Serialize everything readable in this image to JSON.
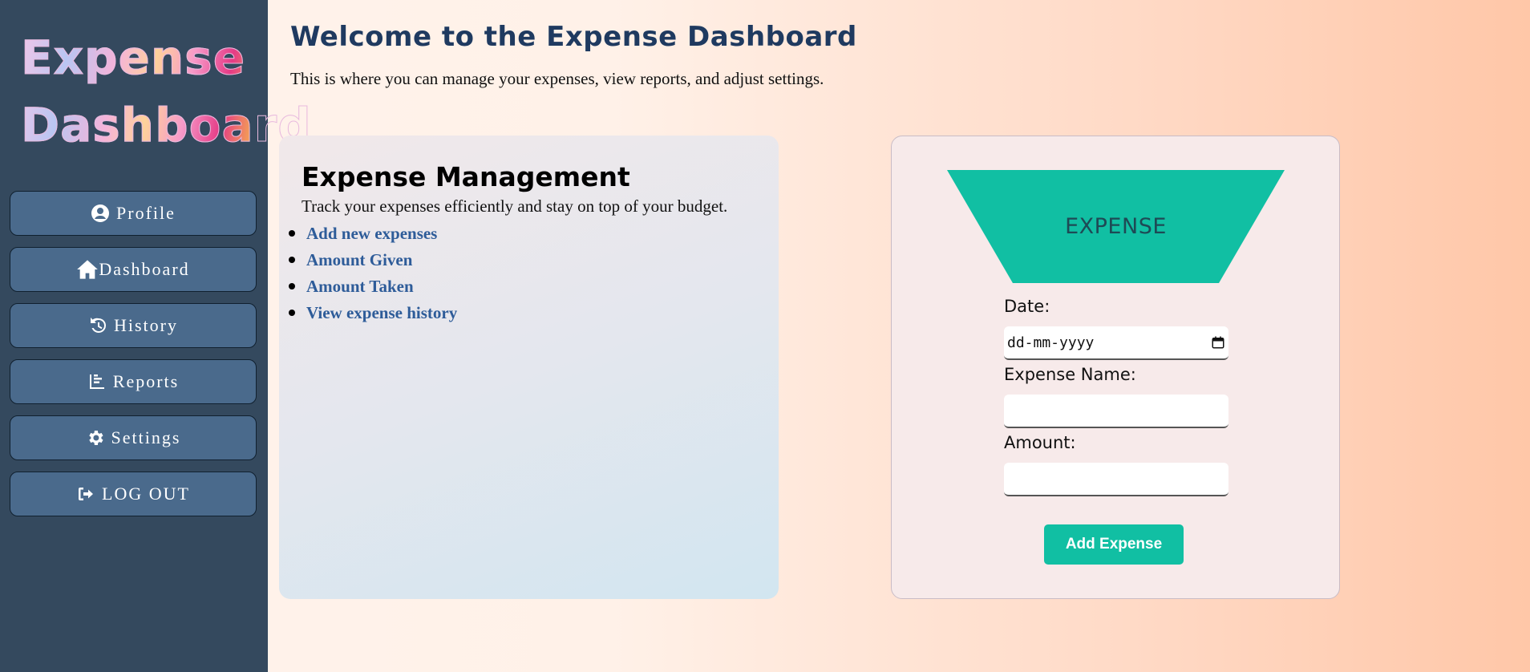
{
  "sidebar": {
    "logo_line1": "Expense",
    "logo_line2": "Dashboard",
    "items": [
      {
        "label": "Profile",
        "icon": "user-circle-icon"
      },
      {
        "label": "Dashboard",
        "icon": "home-icon"
      },
      {
        "label": "History",
        "icon": "history-icon"
      },
      {
        "label": "Reports",
        "icon": "chart-icon"
      },
      {
        "label": "Settings",
        "icon": "gear-icon"
      },
      {
        "label": "LOG OUT",
        "icon": "logout-icon"
      }
    ]
  },
  "header": {
    "title": "Welcome to the Expense Dashboard",
    "subtitle": "This is where you can manage your expenses, view reports, and adjust settings."
  },
  "management": {
    "title": "Expense Management",
    "description": "Track your expenses efficiently and stay on top of your budget.",
    "links": [
      "Add new expenses",
      "Amount Given",
      "Amount Taken",
      "View expense history"
    ]
  },
  "form": {
    "banner": "EXPENSE",
    "date_label": "Date:",
    "date_placeholder": "dd-mm-yyyy",
    "name_label": "Expense Name:",
    "name_value": "",
    "amount_label": "Amount:",
    "amount_value": "",
    "submit_label": "Add Expense"
  },
  "colors": {
    "sidebar_bg": "#34495e",
    "nav_button": "#4a6a8c",
    "accent_teal": "#11bfa3",
    "title_blue": "#1f3a60",
    "link_blue": "#2e5c99"
  }
}
